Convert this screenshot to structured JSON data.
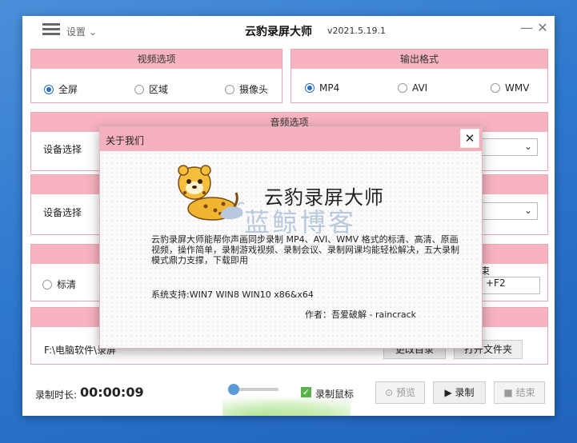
{
  "window": {
    "settings_label": "设置",
    "app_title": "云豹录屏大师",
    "version": "v2021.5.19.1",
    "minimize_glyph": "—",
    "close_glyph": "✕"
  },
  "video_options": {
    "title": "视频选项",
    "options": [
      "全屏",
      "区域",
      "摄像头"
    ],
    "selected": "全屏"
  },
  "output_format": {
    "title": "输出格式",
    "options": [
      "MP4",
      "AVI",
      "WMV"
    ],
    "selected": "MP4"
  },
  "audio_options": {
    "title": "音频选项",
    "device_label": "设备选择"
  },
  "second_panel": {
    "device_label": "设备选择"
  },
  "quality_panel": {
    "option_label": "标清",
    "hotkey_label_partial": "束",
    "hotkey_value_partial": "+F2"
  },
  "path_panel": {
    "path": "F:\\电脑软件\\录屏",
    "change_dir_button": "更改目录",
    "open_folder_button": "打开文件夹"
  },
  "bottom": {
    "duration_label": "录制时长:",
    "duration_value": "00:00:09",
    "record_mouse_label": "录制鼠标",
    "record_mouse_checked": true,
    "preview_button": "预览",
    "record_button": "录制",
    "stop_button": "结束"
  },
  "about_dialog": {
    "title": "关于我们",
    "close_glyph": "✕",
    "brand": "云豹录屏大师",
    "watermark": "蓝鲸博客",
    "description": "云豹录屏大师能帮你声画同步录制 MP4、AVI、WMV 格式的标清、高清、原画视频，操作简单，录制游戏视频、录制会议、录制网课均能轻松解决，五大录制模式鼎力支撑，下载即用",
    "system_support": "系统支持:WIN7 WIN8 WIN10      x86&x64",
    "author": "作者：吾爱破解 - raincrack"
  },
  "colors": {
    "accent_pink": "#f7b3c0",
    "radio_blue": "#2b6cc4",
    "desktop_blue": "#2f78cf"
  }
}
